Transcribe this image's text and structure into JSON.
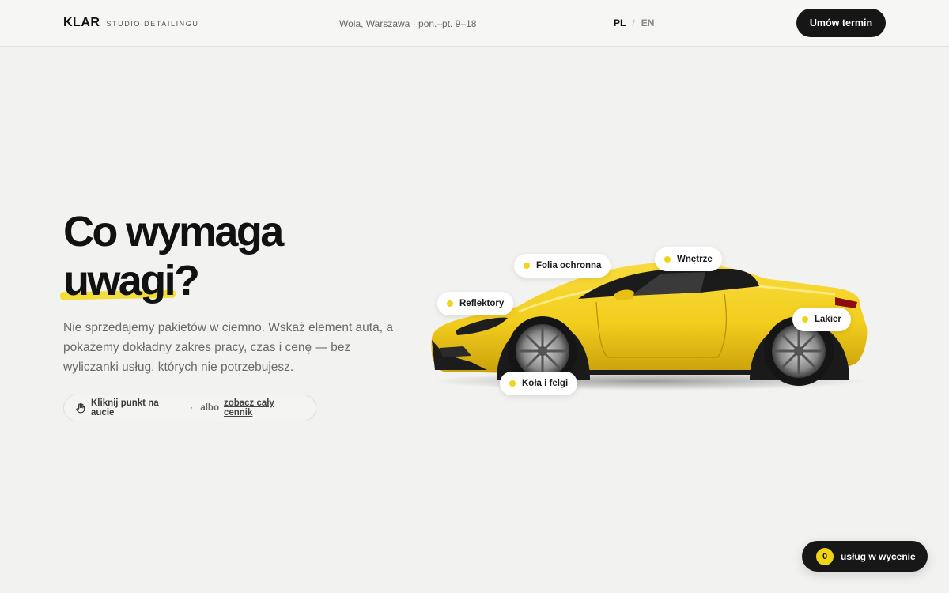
{
  "header": {
    "logo_mark": "KLAR",
    "logo_sub": "STUDIO DETAILINGU",
    "location": "Wola, Warszawa · pon.–pt. 9–18",
    "lang_pl": "PL",
    "lang_sep": "/",
    "lang_en": "EN",
    "cta_label": "Umów termin"
  },
  "hero": {
    "headline_line1": "Co wymaga",
    "headline_line2_word": "uwagi",
    "headline_line2_tail": "?",
    "lead": "Nie sprzedajemy pakietów w ciemno. Wskaż element auta, a pokażemy dokładny zakres pracy, czas i cenę — bez wyliczanki usług, których nie potrzebujesz.",
    "hint_icon": "hand-pointer-icon",
    "hint_text": "Kliknij punkt na aucie",
    "hint_dot": "·",
    "hint_or": "albo",
    "hint_link": "zobacz cały cennik"
  },
  "car": {
    "color": "#f2cd1d",
    "hotspots": [
      {
        "id": "folia",
        "label": "Folia ochronna"
      },
      {
        "id": "wnetrze",
        "label": "Wnętrze"
      },
      {
        "id": "reflektory",
        "label": "Reflektory"
      },
      {
        "id": "lakier",
        "label": "Lakier"
      },
      {
        "id": "kola",
        "label": "Koła i felgi"
      }
    ]
  },
  "cart": {
    "count": "0",
    "label": "usług w wycenie"
  },
  "colors": {
    "accent": "#f0d416",
    "background": "#f2f2f0",
    "dark": "#161616"
  }
}
